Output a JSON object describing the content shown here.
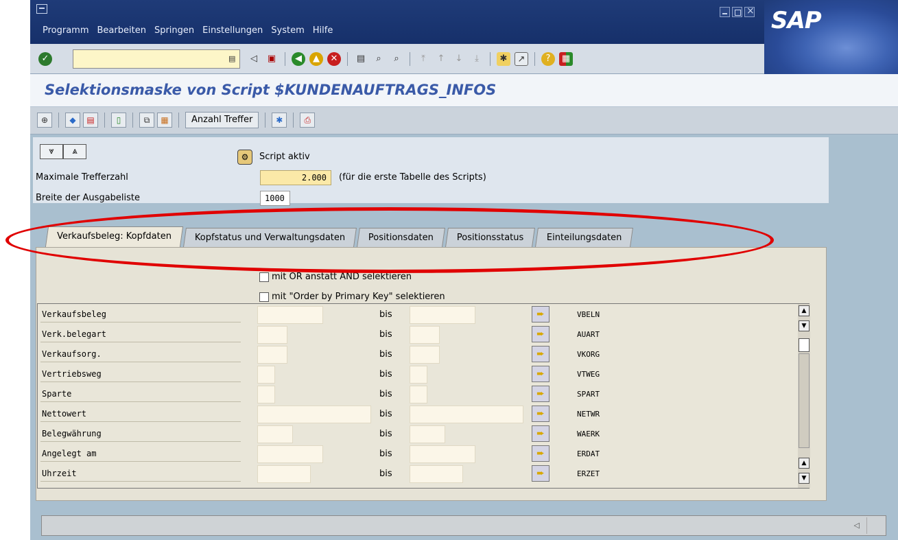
{
  "menu": [
    "Programm",
    "Bearbeiten",
    "Springen",
    "Einstellungen",
    "System",
    "Hilfe"
  ],
  "brand": "SAP",
  "screen_title": "Selektionsmaske von Script $KUNDENAUFTRAGS_INFOS",
  "app_toolbar": {
    "anzahl_treffer": "Anzahl Treffer"
  },
  "header": {
    "script_aktiv": "Script aktiv",
    "max_treffer_label": "Maximale Trefferzahl",
    "max_treffer_value": "2.000",
    "max_treffer_hint": "(für die erste Tabelle des Scripts)",
    "breite_label": "Breite der Ausgabeliste",
    "breite_value": "1000"
  },
  "tabs": [
    {
      "label": "Verkaufsbeleg: Kopfdaten",
      "active": true
    },
    {
      "label": "Kopfstatus und Verwaltungsdaten",
      "active": false
    },
    {
      "label": "Positionsdaten",
      "active": false
    },
    {
      "label": "Positionsstatus",
      "active": false
    },
    {
      "label": "Einteilungsdaten",
      "active": false
    }
  ],
  "options": {
    "or_instead_and": "mit OR anstatt AND selektieren",
    "order_by_pk": "mit \"Order by Primary Key\" selektieren"
  },
  "bis_label": "bis",
  "rows": [
    {
      "label": "Verkaufsbeleg",
      "field": "VBELN"
    },
    {
      "label": "Verk.belegart",
      "field": "AUART"
    },
    {
      "label": "Verkaufsorg.",
      "field": "VKORG"
    },
    {
      "label": "Vertriebsweg",
      "field": "VTWEG"
    },
    {
      "label": "Sparte",
      "field": "SPART"
    },
    {
      "label": "Nettowert",
      "field": "NETWR"
    },
    {
      "label": "Belegwährung",
      "field": "WAERK"
    },
    {
      "label": "Angelegt am",
      "field": "ERDAT"
    },
    {
      "label": "Uhrzeit",
      "field": "ERZET"
    }
  ],
  "colors": {
    "title_bar": "#1f3b78",
    "screen_title": "#3a5aa8",
    "highlight": "#e00000",
    "input_highlight": "#fbe9a8"
  }
}
